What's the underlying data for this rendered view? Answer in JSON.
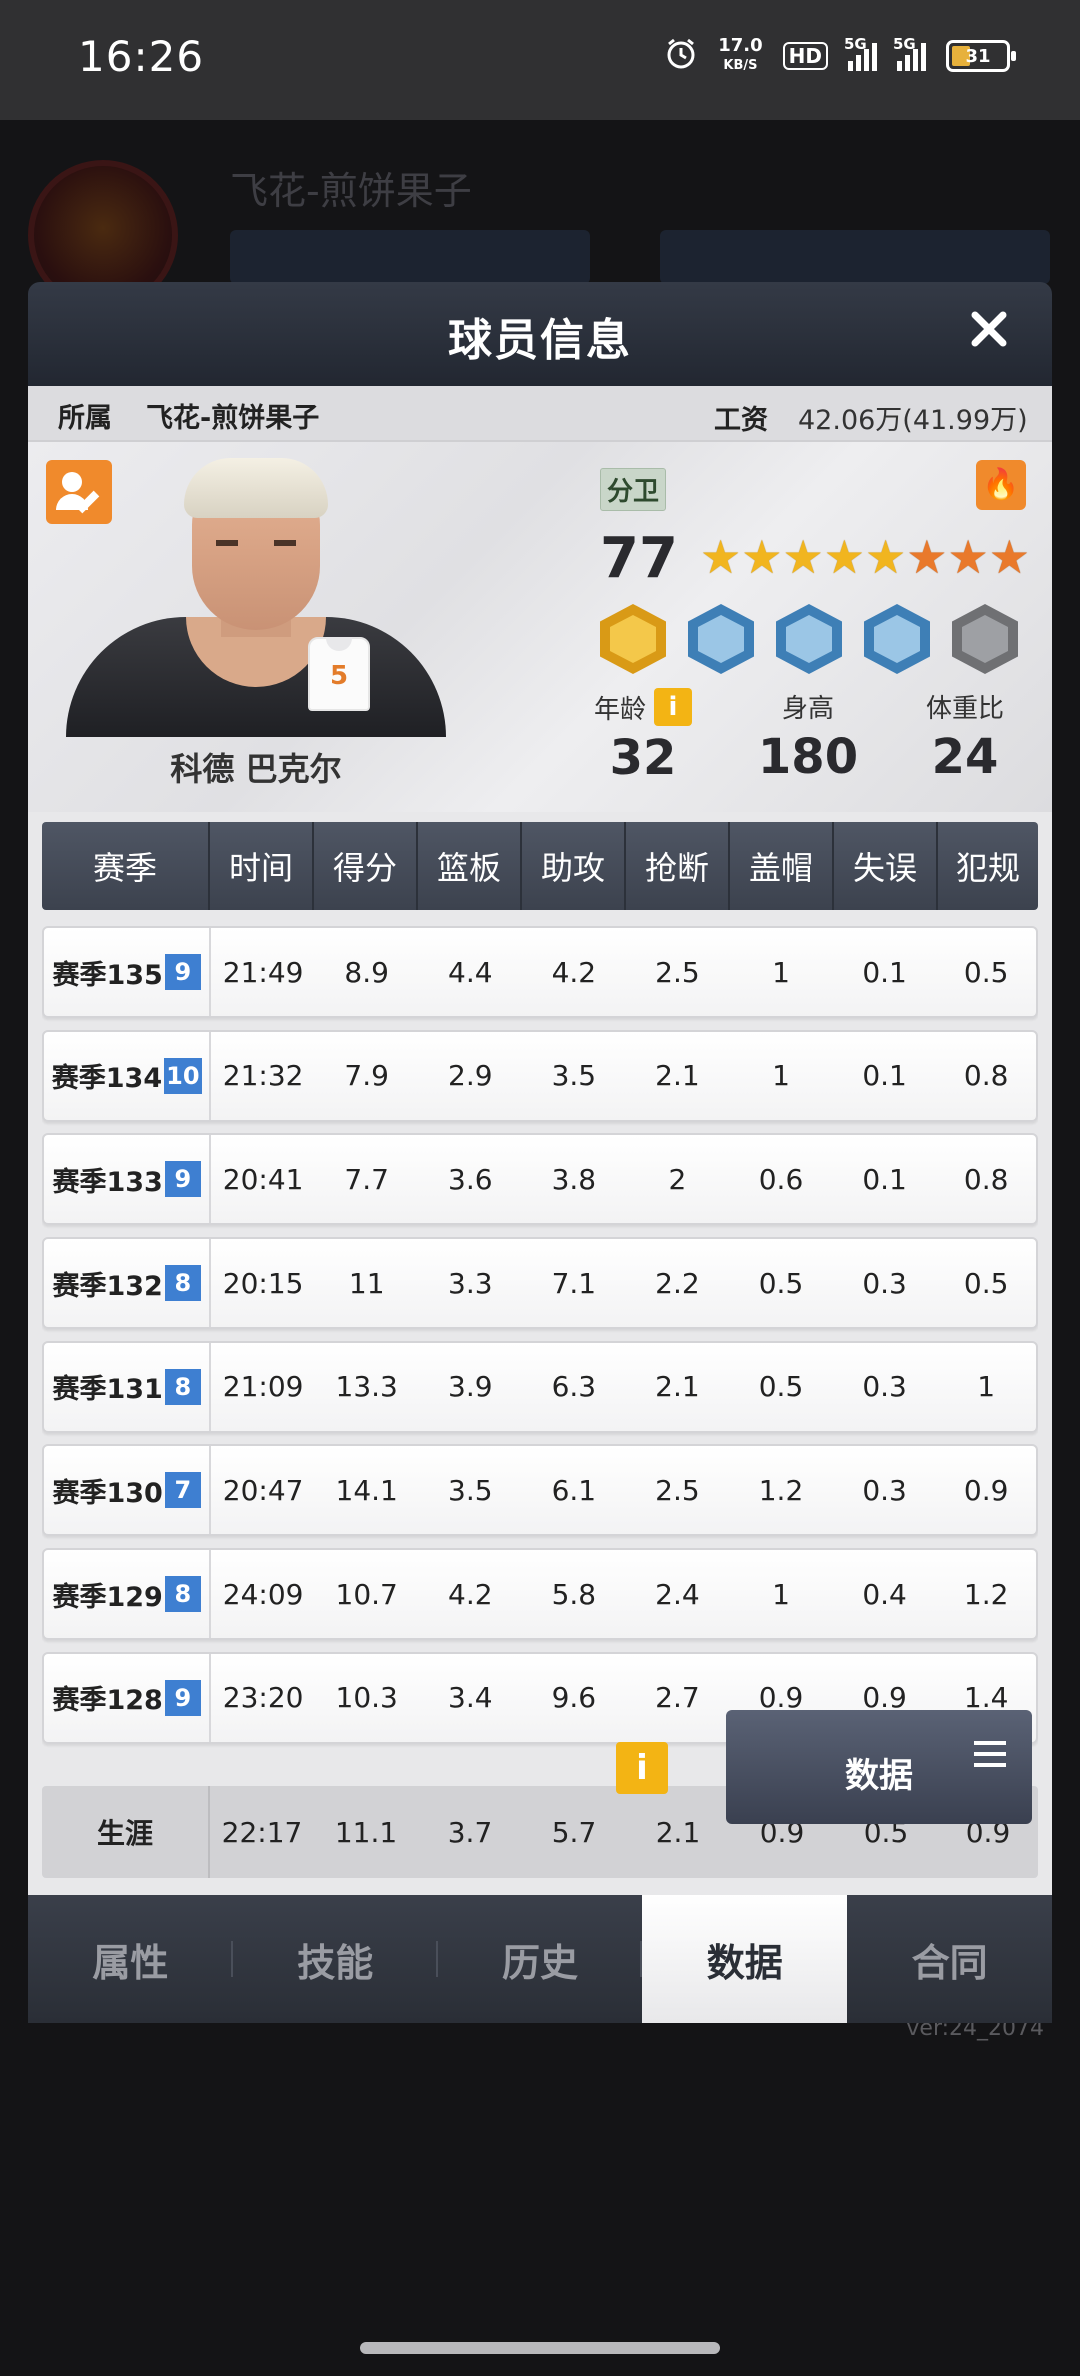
{
  "status_bar": {
    "time": "16:26",
    "net_speed_value": "17.0",
    "net_speed_unit": "KB/S",
    "hd_label": "HD",
    "sim1_label": "5G",
    "sim2_label": "5G",
    "battery": "31",
    "icons": [
      "alarm-icon",
      "hd-icon",
      "signal-icon",
      "signal-icon",
      "battery-icon"
    ]
  },
  "background": {
    "team_name": "飞花-煎饼果子",
    "version": "ver:24_2074"
  },
  "modal": {
    "title": "球员信息",
    "close_icon": "close-icon",
    "info": {
      "team_label": "所属",
      "team_name": "飞花-煎饼果子",
      "salary_label": "工资",
      "salary_value": "42.06万(41.99万)"
    },
    "player": {
      "name": "科德 巴克尔",
      "jersey_number": "5",
      "position": "分卫",
      "overall": "77",
      "stars": {
        "gold": 5,
        "orange": 3
      },
      "badges": [
        "gold",
        "blue",
        "blue",
        "blue",
        "gray"
      ],
      "age_label": "年龄",
      "age": "32",
      "height_label": "身高",
      "height": "180",
      "weight_label": "体重比",
      "weight": "24",
      "info_icon_text": "i"
    },
    "table": {
      "headers": [
        "赛季",
        "时间",
        "得分",
        "篮板",
        "助攻",
        "抢断",
        "盖帽",
        "失误",
        "犯规"
      ],
      "rows": [
        {
          "season": "赛季135",
          "tag": "9",
          "time": "21:49",
          "pts": "8.9",
          "reb": "4.4",
          "ast": "4.2",
          "stl": "2.5",
          "blk": "1",
          "tov": "0.1",
          "pf": "0.5"
        },
        {
          "season": "赛季134",
          "tag": "10",
          "time": "21:32",
          "pts": "7.9",
          "reb": "2.9",
          "ast": "3.5",
          "stl": "2.1",
          "blk": "1",
          "tov": "0.1",
          "pf": "0.8"
        },
        {
          "season": "赛季133",
          "tag": "9",
          "time": "20:41",
          "pts": "7.7",
          "reb": "3.6",
          "ast": "3.8",
          "stl": "2",
          "blk": "0.6",
          "tov": "0.1",
          "pf": "0.8"
        },
        {
          "season": "赛季132",
          "tag": "8",
          "time": "20:15",
          "pts": "11",
          "reb": "3.3",
          "ast": "7.1",
          "stl": "2.2",
          "blk": "0.5",
          "tov": "0.3",
          "pf": "0.5"
        },
        {
          "season": "赛季131",
          "tag": "8",
          "time": "21:09",
          "pts": "13.3",
          "reb": "3.9",
          "ast": "6.3",
          "stl": "2.1",
          "blk": "0.5",
          "tov": "0.3",
          "pf": "1"
        },
        {
          "season": "赛季130",
          "tag": "7",
          "time": "20:47",
          "pts": "14.1",
          "reb": "3.5",
          "ast": "6.1",
          "stl": "2.5",
          "blk": "1.2",
          "tov": "0.3",
          "pf": "0.9"
        },
        {
          "season": "赛季129",
          "tag": "8",
          "time": "24:09",
          "pts": "10.7",
          "reb": "4.2",
          "ast": "5.8",
          "stl": "2.4",
          "blk": "1",
          "tov": "0.4",
          "pf": "1.2"
        },
        {
          "season": "赛季128",
          "tag": "9",
          "time": "23:20",
          "pts": "10.3",
          "reb": "3.4",
          "ast": "9.6",
          "stl": "2.7",
          "blk": "0.9",
          "tov": "0.9",
          "pf": "1.4"
        }
      ],
      "career": {
        "label": "生涯",
        "time": "22:17",
        "pts": "11.1",
        "reb": "3.7",
        "ast": "5.7",
        "stl": "2.1",
        "blk": "0.9",
        "tov": "0.5",
        "pf": "0.9"
      }
    },
    "info_button_text": "i",
    "data_button_label": "数据",
    "data_button_icon": "menu-icon",
    "tabs": [
      {
        "label": "属性",
        "active": false
      },
      {
        "label": "技能",
        "active": false
      },
      {
        "label": "历史",
        "active": false
      },
      {
        "label": "数据",
        "active": true
      },
      {
        "label": "合同",
        "active": false
      }
    ]
  }
}
